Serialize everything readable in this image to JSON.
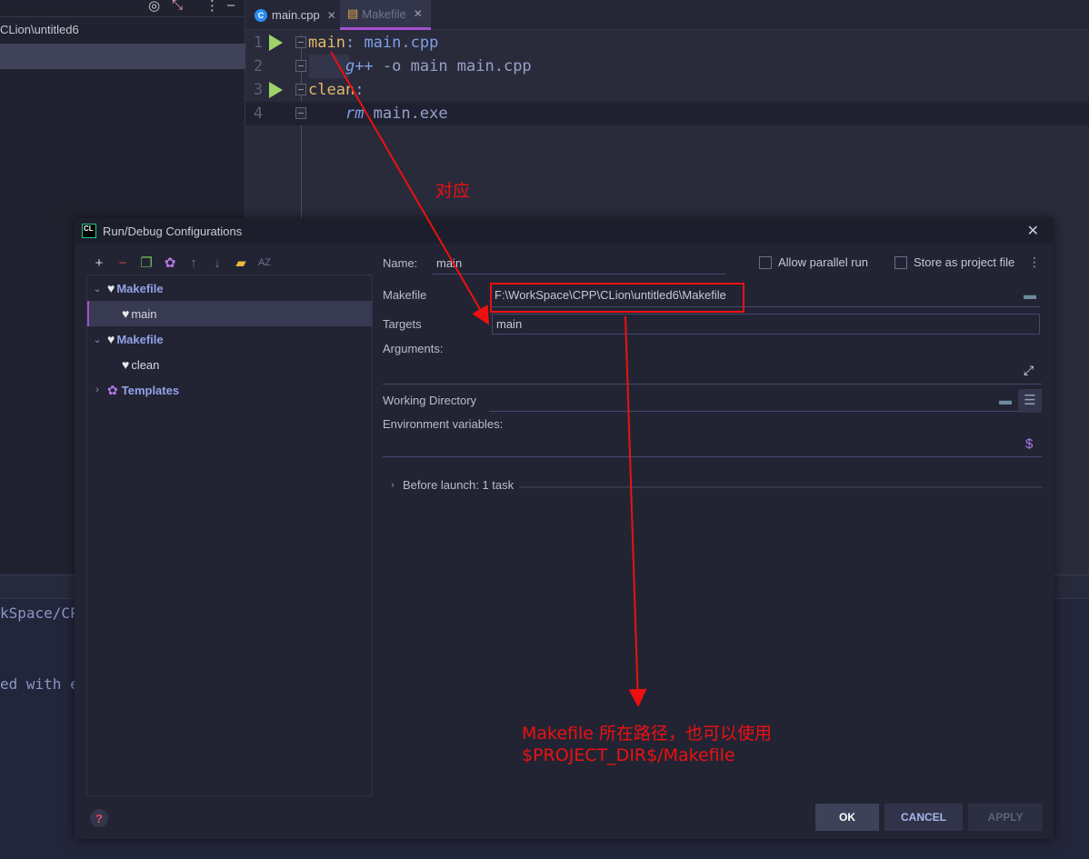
{
  "left_panel": {
    "project_path_partial": "CLion\\untitled6",
    "toolbar_icons": [
      "target-icon",
      "collapse-icon",
      "more-icon",
      "minimize-icon"
    ]
  },
  "editor": {
    "tabs": [
      {
        "label": "main.cpp",
        "icon": "cpp-file-icon",
        "active": false
      },
      {
        "label": "Makefile",
        "icon": "makefile-icon",
        "active": true
      }
    ],
    "lines": [
      {
        "number": "1",
        "target": "main",
        "sep": ":",
        "rest": " main.cpp",
        "runnable": true
      },
      {
        "number": "2",
        "cmd": "g++",
        "rest": " -o main main.cpp",
        "runnable": false
      },
      {
        "number": "3",
        "target": "clean",
        "sep": ":",
        "rest": "",
        "runnable": true
      },
      {
        "number": "4",
        "cmd": "rm",
        "rest": " main.exe",
        "runnable": false
      }
    ]
  },
  "console": {
    "line1": "kSpace/CP",
    "line2": "ed with e"
  },
  "dialog": {
    "title": "Run/Debug Configurations",
    "logo": "CL",
    "toolbar": [
      "add-icon",
      "remove-icon",
      "copy-icon",
      "settings-icon",
      "move-up-icon",
      "move-down-icon",
      "new-folder-icon",
      "sort-icon"
    ],
    "tree": [
      {
        "label": "Makefile",
        "type": "group",
        "expanded": true
      },
      {
        "label": "main",
        "type": "leaf",
        "selected": true
      },
      {
        "label": "Makefile",
        "type": "group",
        "expanded": true
      },
      {
        "label": "clean",
        "type": "leaf",
        "selected": false
      },
      {
        "label": "Templates",
        "type": "templates",
        "expanded": false
      }
    ],
    "form": {
      "name_label": "Name:",
      "name_value": "main",
      "allow_parallel_label": "Allow parallel run",
      "allow_parallel_checked": false,
      "store_project_label": "Store as project file",
      "store_project_checked": false,
      "makefile_label": "Makefile",
      "makefile_value": "F:\\WorkSpace\\CPP\\CLion\\untitled6\\Makefile",
      "targets_label": "Targets",
      "targets_value": "main",
      "arguments_label": "Arguments:",
      "arguments_value": "",
      "working_dir_label": "Working Directory",
      "working_dir_value": "",
      "env_label": "Environment variables:",
      "env_value": "",
      "before_launch": "Before launch: 1 task"
    },
    "buttons": {
      "ok": "OK",
      "cancel": "CANCEL",
      "apply": "APPLY"
    }
  },
  "annotations": {
    "correspond": "对应",
    "makefile_note_line1": "Makefile 所在路径，也可以使用",
    "makefile_note_line2": "$PROJECT_DIR$/Makefile",
    "color": "#ee1010"
  }
}
